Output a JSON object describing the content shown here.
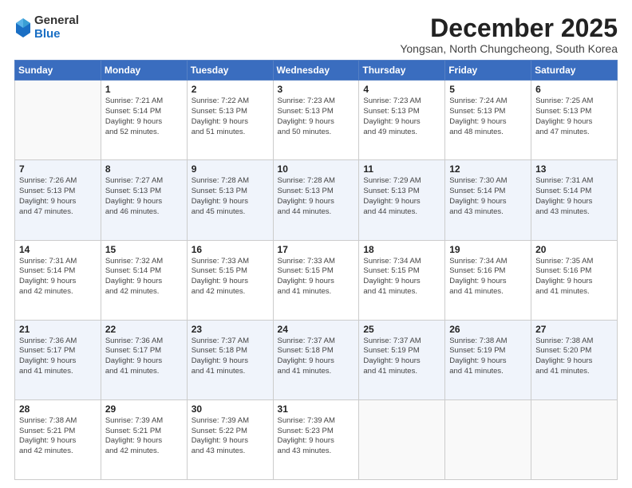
{
  "logo": {
    "general": "General",
    "blue": "Blue"
  },
  "title": "December 2025",
  "subtitle": "Yongsan, North Chungcheong, South Korea",
  "days_of_week": [
    "Sunday",
    "Monday",
    "Tuesday",
    "Wednesday",
    "Thursday",
    "Friday",
    "Saturday"
  ],
  "weeks": [
    [
      {
        "day": "",
        "info": ""
      },
      {
        "day": "1",
        "info": "Sunrise: 7:21 AM\nSunset: 5:14 PM\nDaylight: 9 hours\nand 52 minutes."
      },
      {
        "day": "2",
        "info": "Sunrise: 7:22 AM\nSunset: 5:13 PM\nDaylight: 9 hours\nand 51 minutes."
      },
      {
        "day": "3",
        "info": "Sunrise: 7:23 AM\nSunset: 5:13 PM\nDaylight: 9 hours\nand 50 minutes."
      },
      {
        "day": "4",
        "info": "Sunrise: 7:23 AM\nSunset: 5:13 PM\nDaylight: 9 hours\nand 49 minutes."
      },
      {
        "day": "5",
        "info": "Sunrise: 7:24 AM\nSunset: 5:13 PM\nDaylight: 9 hours\nand 48 minutes."
      },
      {
        "day": "6",
        "info": "Sunrise: 7:25 AM\nSunset: 5:13 PM\nDaylight: 9 hours\nand 47 minutes."
      }
    ],
    [
      {
        "day": "7",
        "info": "Sunrise: 7:26 AM\nSunset: 5:13 PM\nDaylight: 9 hours\nand 47 minutes."
      },
      {
        "day": "8",
        "info": "Sunrise: 7:27 AM\nSunset: 5:13 PM\nDaylight: 9 hours\nand 46 minutes."
      },
      {
        "day": "9",
        "info": "Sunrise: 7:28 AM\nSunset: 5:13 PM\nDaylight: 9 hours\nand 45 minutes."
      },
      {
        "day": "10",
        "info": "Sunrise: 7:28 AM\nSunset: 5:13 PM\nDaylight: 9 hours\nand 44 minutes."
      },
      {
        "day": "11",
        "info": "Sunrise: 7:29 AM\nSunset: 5:13 PM\nDaylight: 9 hours\nand 44 minutes."
      },
      {
        "day": "12",
        "info": "Sunrise: 7:30 AM\nSunset: 5:14 PM\nDaylight: 9 hours\nand 43 minutes."
      },
      {
        "day": "13",
        "info": "Sunrise: 7:31 AM\nSunset: 5:14 PM\nDaylight: 9 hours\nand 43 minutes."
      }
    ],
    [
      {
        "day": "14",
        "info": "Sunrise: 7:31 AM\nSunset: 5:14 PM\nDaylight: 9 hours\nand 42 minutes."
      },
      {
        "day": "15",
        "info": "Sunrise: 7:32 AM\nSunset: 5:14 PM\nDaylight: 9 hours\nand 42 minutes."
      },
      {
        "day": "16",
        "info": "Sunrise: 7:33 AM\nSunset: 5:15 PM\nDaylight: 9 hours\nand 42 minutes."
      },
      {
        "day": "17",
        "info": "Sunrise: 7:33 AM\nSunset: 5:15 PM\nDaylight: 9 hours\nand 41 minutes."
      },
      {
        "day": "18",
        "info": "Sunrise: 7:34 AM\nSunset: 5:15 PM\nDaylight: 9 hours\nand 41 minutes."
      },
      {
        "day": "19",
        "info": "Sunrise: 7:34 AM\nSunset: 5:16 PM\nDaylight: 9 hours\nand 41 minutes."
      },
      {
        "day": "20",
        "info": "Sunrise: 7:35 AM\nSunset: 5:16 PM\nDaylight: 9 hours\nand 41 minutes."
      }
    ],
    [
      {
        "day": "21",
        "info": "Sunrise: 7:36 AM\nSunset: 5:17 PM\nDaylight: 9 hours\nand 41 minutes."
      },
      {
        "day": "22",
        "info": "Sunrise: 7:36 AM\nSunset: 5:17 PM\nDaylight: 9 hours\nand 41 minutes."
      },
      {
        "day": "23",
        "info": "Sunrise: 7:37 AM\nSunset: 5:18 PM\nDaylight: 9 hours\nand 41 minutes."
      },
      {
        "day": "24",
        "info": "Sunrise: 7:37 AM\nSunset: 5:18 PM\nDaylight: 9 hours\nand 41 minutes."
      },
      {
        "day": "25",
        "info": "Sunrise: 7:37 AM\nSunset: 5:19 PM\nDaylight: 9 hours\nand 41 minutes."
      },
      {
        "day": "26",
        "info": "Sunrise: 7:38 AM\nSunset: 5:19 PM\nDaylight: 9 hours\nand 41 minutes."
      },
      {
        "day": "27",
        "info": "Sunrise: 7:38 AM\nSunset: 5:20 PM\nDaylight: 9 hours\nand 41 minutes."
      }
    ],
    [
      {
        "day": "28",
        "info": "Sunrise: 7:38 AM\nSunset: 5:21 PM\nDaylight: 9 hours\nand 42 minutes."
      },
      {
        "day": "29",
        "info": "Sunrise: 7:39 AM\nSunset: 5:21 PM\nDaylight: 9 hours\nand 42 minutes."
      },
      {
        "day": "30",
        "info": "Sunrise: 7:39 AM\nSunset: 5:22 PM\nDaylight: 9 hours\nand 43 minutes."
      },
      {
        "day": "31",
        "info": "Sunrise: 7:39 AM\nSunset: 5:23 PM\nDaylight: 9 hours\nand 43 minutes."
      },
      {
        "day": "",
        "info": ""
      },
      {
        "day": "",
        "info": ""
      },
      {
        "day": "",
        "info": ""
      }
    ]
  ]
}
